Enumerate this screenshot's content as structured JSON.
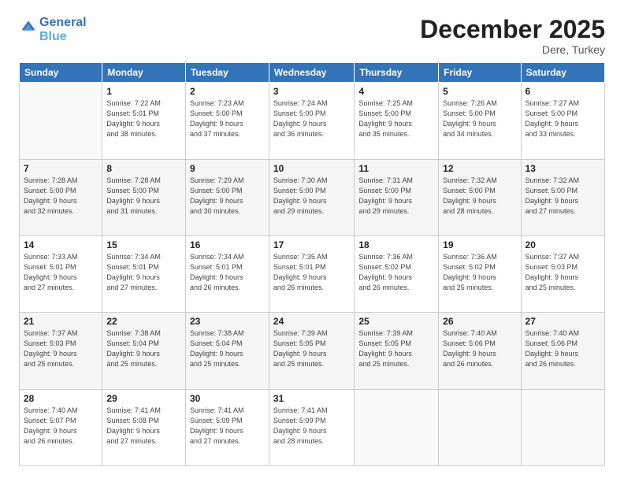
{
  "header": {
    "logo_line1": "General",
    "logo_line2": "Blue",
    "month_title": "December 2025",
    "location": "Dere, Turkey"
  },
  "days_of_week": [
    "Sunday",
    "Monday",
    "Tuesday",
    "Wednesday",
    "Thursday",
    "Friday",
    "Saturday"
  ],
  "weeks": [
    [
      {
        "day": "",
        "info": ""
      },
      {
        "day": "1",
        "info": "Sunrise: 7:22 AM\nSunset: 5:01 PM\nDaylight: 9 hours\nand 38 minutes."
      },
      {
        "day": "2",
        "info": "Sunrise: 7:23 AM\nSunset: 5:00 PM\nDaylight: 9 hours\nand 37 minutes."
      },
      {
        "day": "3",
        "info": "Sunrise: 7:24 AM\nSunset: 5:00 PM\nDaylight: 9 hours\nand 36 minutes."
      },
      {
        "day": "4",
        "info": "Sunrise: 7:25 AM\nSunset: 5:00 PM\nDaylight: 9 hours\nand 35 minutes."
      },
      {
        "day": "5",
        "info": "Sunrise: 7:26 AM\nSunset: 5:00 PM\nDaylight: 9 hours\nand 34 minutes."
      },
      {
        "day": "6",
        "info": "Sunrise: 7:27 AM\nSunset: 5:00 PM\nDaylight: 9 hours\nand 33 minutes."
      }
    ],
    [
      {
        "day": "7",
        "info": "Sunrise: 7:28 AM\nSunset: 5:00 PM\nDaylight: 9 hours\nand 32 minutes."
      },
      {
        "day": "8",
        "info": "Sunrise: 7:28 AM\nSunset: 5:00 PM\nDaylight: 9 hours\nand 31 minutes."
      },
      {
        "day": "9",
        "info": "Sunrise: 7:29 AM\nSunset: 5:00 PM\nDaylight: 9 hours\nand 30 minutes."
      },
      {
        "day": "10",
        "info": "Sunrise: 7:30 AM\nSunset: 5:00 PM\nDaylight: 9 hours\nand 29 minutes."
      },
      {
        "day": "11",
        "info": "Sunrise: 7:31 AM\nSunset: 5:00 PM\nDaylight: 9 hours\nand 29 minutes."
      },
      {
        "day": "12",
        "info": "Sunrise: 7:32 AM\nSunset: 5:00 PM\nDaylight: 9 hours\nand 28 minutes."
      },
      {
        "day": "13",
        "info": "Sunrise: 7:32 AM\nSunset: 5:00 PM\nDaylight: 9 hours\nand 27 minutes."
      }
    ],
    [
      {
        "day": "14",
        "info": "Sunrise: 7:33 AM\nSunset: 5:01 PM\nDaylight: 9 hours\nand 27 minutes."
      },
      {
        "day": "15",
        "info": "Sunrise: 7:34 AM\nSunset: 5:01 PM\nDaylight: 9 hours\nand 27 minutes."
      },
      {
        "day": "16",
        "info": "Sunrise: 7:34 AM\nSunset: 5:01 PM\nDaylight: 9 hours\nand 26 minutes."
      },
      {
        "day": "17",
        "info": "Sunrise: 7:35 AM\nSunset: 5:01 PM\nDaylight: 9 hours\nand 26 minutes."
      },
      {
        "day": "18",
        "info": "Sunrise: 7:36 AM\nSunset: 5:02 PM\nDaylight: 9 hours\nand 26 minutes."
      },
      {
        "day": "19",
        "info": "Sunrise: 7:36 AM\nSunset: 5:02 PM\nDaylight: 9 hours\nand 25 minutes."
      },
      {
        "day": "20",
        "info": "Sunrise: 7:37 AM\nSunset: 5:03 PM\nDaylight: 9 hours\nand 25 minutes."
      }
    ],
    [
      {
        "day": "21",
        "info": "Sunrise: 7:37 AM\nSunset: 5:03 PM\nDaylight: 9 hours\nand 25 minutes."
      },
      {
        "day": "22",
        "info": "Sunrise: 7:38 AM\nSunset: 5:04 PM\nDaylight: 9 hours\nand 25 minutes."
      },
      {
        "day": "23",
        "info": "Sunrise: 7:38 AM\nSunset: 5:04 PM\nDaylight: 9 hours\nand 25 minutes."
      },
      {
        "day": "24",
        "info": "Sunrise: 7:39 AM\nSunset: 5:05 PM\nDaylight: 9 hours\nand 25 minutes."
      },
      {
        "day": "25",
        "info": "Sunrise: 7:39 AM\nSunset: 5:05 PM\nDaylight: 9 hours\nand 25 minutes."
      },
      {
        "day": "26",
        "info": "Sunrise: 7:40 AM\nSunset: 5:06 PM\nDaylight: 9 hours\nand 26 minutes."
      },
      {
        "day": "27",
        "info": "Sunrise: 7:40 AM\nSunset: 5:06 PM\nDaylight: 9 hours\nand 26 minutes."
      }
    ],
    [
      {
        "day": "28",
        "info": "Sunrise: 7:40 AM\nSunset: 5:07 PM\nDaylight: 9 hours\nand 26 minutes."
      },
      {
        "day": "29",
        "info": "Sunrise: 7:41 AM\nSunset: 5:08 PM\nDaylight: 9 hours\nand 27 minutes."
      },
      {
        "day": "30",
        "info": "Sunrise: 7:41 AM\nSunset: 5:09 PM\nDaylight: 9 hours\nand 27 minutes."
      },
      {
        "day": "31",
        "info": "Sunrise: 7:41 AM\nSunset: 5:09 PM\nDaylight: 9 hours\nand 28 minutes."
      },
      {
        "day": "",
        "info": ""
      },
      {
        "day": "",
        "info": ""
      },
      {
        "day": "",
        "info": ""
      }
    ]
  ]
}
